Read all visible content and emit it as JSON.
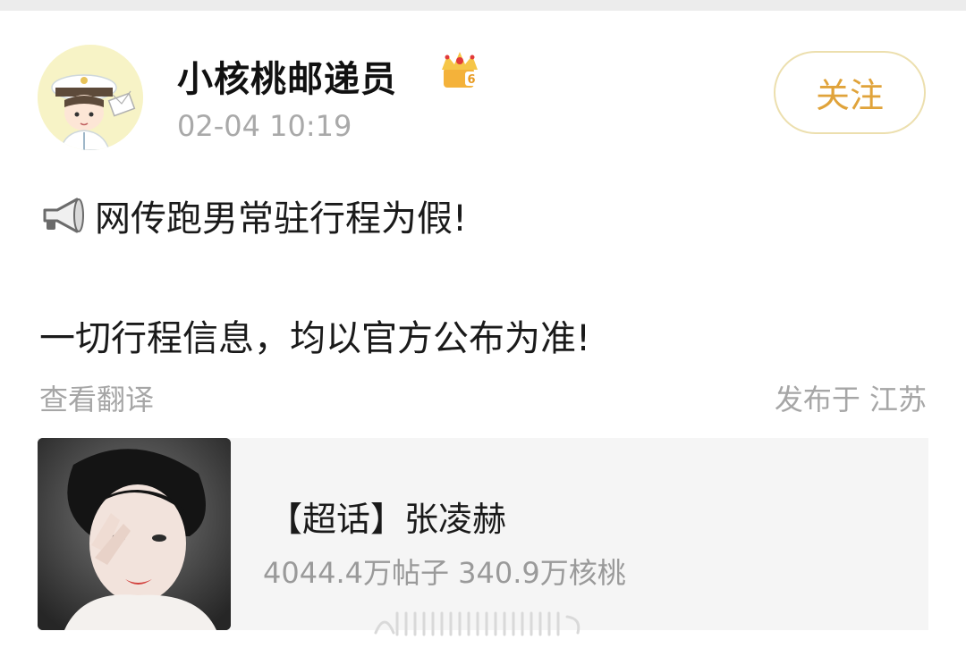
{
  "user": {
    "name": "小核桃邮递员",
    "timestamp": "02-04 10:19",
    "badge_level": "6"
  },
  "actions": {
    "follow_label": "关注"
  },
  "post": {
    "line1": "网传跑男常驻行程为假!",
    "line2": "一切行程信息，均以官方公布为准!"
  },
  "meta": {
    "translate_label": "查看翻译",
    "location": "发布于 江苏"
  },
  "supertopic": {
    "title": "【超话】张凌赫",
    "stats": "4044.4万帖子 340.9万核桃"
  },
  "icons": {
    "megaphone": "megaphone-icon",
    "crown": "crown-badge-icon"
  },
  "colors": {
    "accent": "#e0a33a",
    "follow_border": "#ecdfae",
    "muted_text": "#a6a6a6",
    "card_bg": "#f5f5f5"
  }
}
